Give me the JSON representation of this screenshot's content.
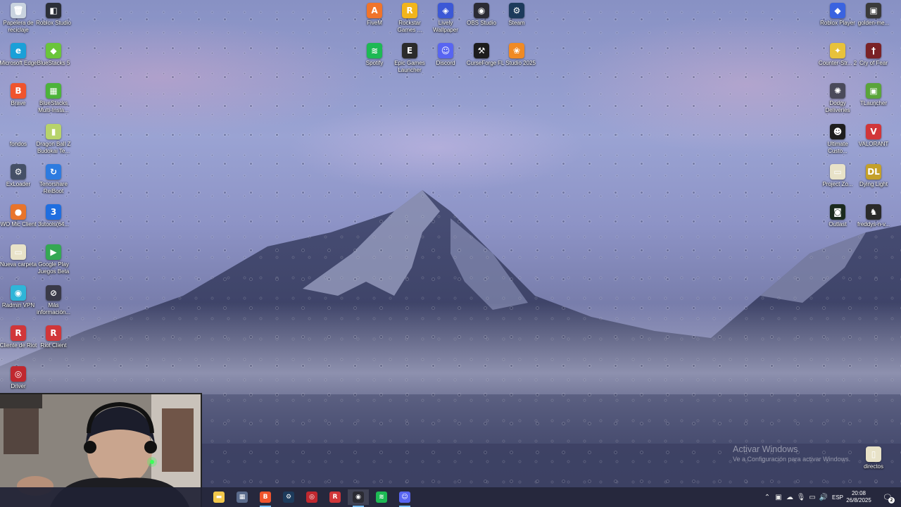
{
  "desktop": {
    "icons": [
      {
        "label": "Papelera de reciclaje",
        "icon": "recycle-bin-icon",
        "color": "#c9d3df",
        "glyph": "🗑"
      },
      {
        "label": "Roblox Studio",
        "icon": "roblox-studio-icon",
        "color": "#2b2f38",
        "glyph": "◧"
      },
      {
        "label": "Microsoft Edge",
        "icon": "edge-icon",
        "color": "#1aa0d8",
        "glyph": "e"
      },
      {
        "label": "BlueStacks 5",
        "icon": "bluestacks-icon",
        "color": "#6ac53a",
        "glyph": "◆"
      },
      {
        "label": "Brave",
        "icon": "brave-icon",
        "color": "#f0542d",
        "glyph": "B"
      },
      {
        "label": "BlueStacks Multi-Insta...",
        "icon": "bluestacks-multi-icon",
        "color": "#4cb33a",
        "glyph": "▦"
      },
      {
        "label": "fondos",
        "icon": "folder-icon",
        "color": "transparent",
        "glyph": ""
      },
      {
        "label": "Dragon Ball Z Budokai Te...",
        "icon": "dragon-ball-icon",
        "color": "#b7d36b",
        "glyph": "▮"
      },
      {
        "label": "ExLoader",
        "icon": "exloader-icon",
        "color": "#455066",
        "glyph": "⚙"
      },
      {
        "label": "Tenorshare ReiBoot",
        "icon": "reiboot-icon",
        "color": "#2d7be0",
        "glyph": "↻"
      },
      {
        "label": "WO Mic Client",
        "icon": "wo-mic-icon",
        "color": "#e8742b",
        "glyph": "●"
      },
      {
        "label": "3utools(64...",
        "icon": "3utools-icon",
        "color": "#1f6ee0",
        "glyph": "3"
      },
      {
        "label": "Nueva carpeta",
        "icon": "new-folder-icon",
        "color": "#e8e2c8",
        "glyph": "▭"
      },
      {
        "label": "Google Play Juegos Beta",
        "icon": "google-play-games-icon",
        "color": "#34a853",
        "glyph": "▶"
      },
      {
        "label": "Radmin VPN",
        "icon": "radmin-vpn-icon",
        "color": "#2fb5d8",
        "glyph": "◉"
      },
      {
        "label": "Más información...",
        "icon": "info-icon",
        "color": "#3a3a48",
        "glyph": "⊘"
      },
      {
        "label": "Cliente de Riot",
        "icon": "riot-client-icon",
        "color": "#d13639",
        "glyph": "R"
      },
      {
        "label": "Riot Client",
        "icon": "riot-client-2-icon",
        "color": "#d13639",
        "glyph": "R"
      },
      {
        "label": "Driver",
        "icon": "driver-icon",
        "color": "#c0282f",
        "glyph": "◎"
      },
      {
        "label": "FiveM",
        "icon": "fivem-icon",
        "color": "#f0742b",
        "glyph": "A"
      },
      {
        "label": "Rockstar Games ...",
        "icon": "rockstar-icon",
        "color": "#f2b51c",
        "glyph": "R"
      },
      {
        "label": "Lively Wallpaper",
        "icon": "lively-wallpaper-icon",
        "color": "#3c58d6",
        "glyph": "◈"
      },
      {
        "label": "OBS Studio",
        "icon": "obs-icon",
        "color": "#2b2b33",
        "glyph": "◉"
      },
      {
        "label": "Steam",
        "icon": "steam-icon",
        "color": "#1d3b5c",
        "glyph": "⚙"
      },
      {
        "label": "Spotify",
        "icon": "spotify-icon",
        "color": "#1db954",
        "glyph": "≋"
      },
      {
        "label": "Epic Games Launcher",
        "icon": "epic-games-icon",
        "color": "#2b2b2b",
        "glyph": "E"
      },
      {
        "label": "Discord",
        "icon": "discord-icon",
        "color": "#5865f2",
        "glyph": "☺"
      },
      {
        "label": "CurseForge",
        "icon": "curseforge-icon",
        "color": "#1c1c1c",
        "glyph": "⚒"
      },
      {
        "label": "FL Studio 2025",
        "icon": "fl-studio-icon",
        "color": "#f08a24",
        "glyph": "❀"
      },
      {
        "label": "Roblox Player",
        "icon": "roblox-player-icon",
        "color": "#3a63e0",
        "glyph": "◆"
      },
      {
        "label": "golden-me...",
        "icon": "golden-image-icon",
        "color": "#3a3a3a",
        "glyph": "▣"
      },
      {
        "label": "Counter-Str... 2",
        "icon": "counter-strike-icon",
        "color": "#e8c23a",
        "glyph": "✦"
      },
      {
        "label": "Cry of Fear",
        "icon": "cry-of-fear-icon",
        "color": "#7a2226",
        "glyph": "†"
      },
      {
        "label": "Dodgy Deliveries",
        "icon": "dodgy-deliveries-icon",
        "color": "#4a4a5a",
        "glyph": "✺"
      },
      {
        "label": "TLauncher",
        "icon": "tlauncher-icon",
        "color": "#5aa43a",
        "glyph": "▣"
      },
      {
        "label": "Ultimate Custo...",
        "icon": "ultimate-custom-night-icon",
        "color": "#1e1e1e",
        "glyph": "☻"
      },
      {
        "label": "VALORANT",
        "icon": "valorant-icon",
        "color": "#d13639",
        "glyph": "V"
      },
      {
        "label": "Project Zo...",
        "icon": "project-zomboid-icon",
        "color": "#e8e2c8",
        "glyph": "▭"
      },
      {
        "label": "Dying Light",
        "icon": "dying-light-icon",
        "color": "#c4a02a",
        "glyph": "DL"
      },
      {
        "label": "Outlast",
        "icon": "outlast-icon",
        "color": "#1b2a1e",
        "glyph": "◙"
      },
      {
        "label": "freddys-n-v...",
        "icon": "freddys-icon",
        "color": "#2a2a2a",
        "glyph": "♞"
      },
      {
        "label": "directos",
        "icon": "directos-folder-icon",
        "color": "#e8e2c8",
        "glyph": "▯"
      }
    ]
  },
  "watermark": {
    "title": "Activar Windows",
    "subtitle": "Ve a Configuración para activar Windows."
  },
  "taskbar": {
    "apps": [
      {
        "name": "file-explorer",
        "icon": "folder-icon",
        "color": "#f2c84b",
        "glyph": "▬",
        "running": false
      },
      {
        "name": "calculator",
        "icon": "calculator-icon",
        "color": "#5a6b8c",
        "glyph": "▦",
        "running": false
      },
      {
        "name": "brave",
        "icon": "brave-icon",
        "color": "#f0542d",
        "glyph": "B",
        "running": true
      },
      {
        "name": "steam",
        "icon": "steam-icon",
        "color": "#1d3b5c",
        "glyph": "⚙",
        "running": false
      },
      {
        "name": "riot-vanguard",
        "icon": "riot-icon",
        "color": "#c0282f",
        "glyph": "◎",
        "running": false
      },
      {
        "name": "riot-client",
        "icon": "riot-client-icon",
        "color": "#d13639",
        "glyph": "R",
        "running": false
      },
      {
        "name": "obs-studio",
        "icon": "obs-icon",
        "color": "#2b2b33",
        "glyph": "◉",
        "running": true
      },
      {
        "name": "spotify",
        "icon": "spotify-icon",
        "color": "#1db954",
        "glyph": "≋",
        "running": false
      },
      {
        "name": "discord",
        "icon": "discord-icon",
        "color": "#5865f2",
        "glyph": "☺",
        "running": true
      }
    ],
    "tray": {
      "language": "ESP",
      "time": "20:08",
      "date": "26/8/2025",
      "notification_count": "2"
    }
  }
}
